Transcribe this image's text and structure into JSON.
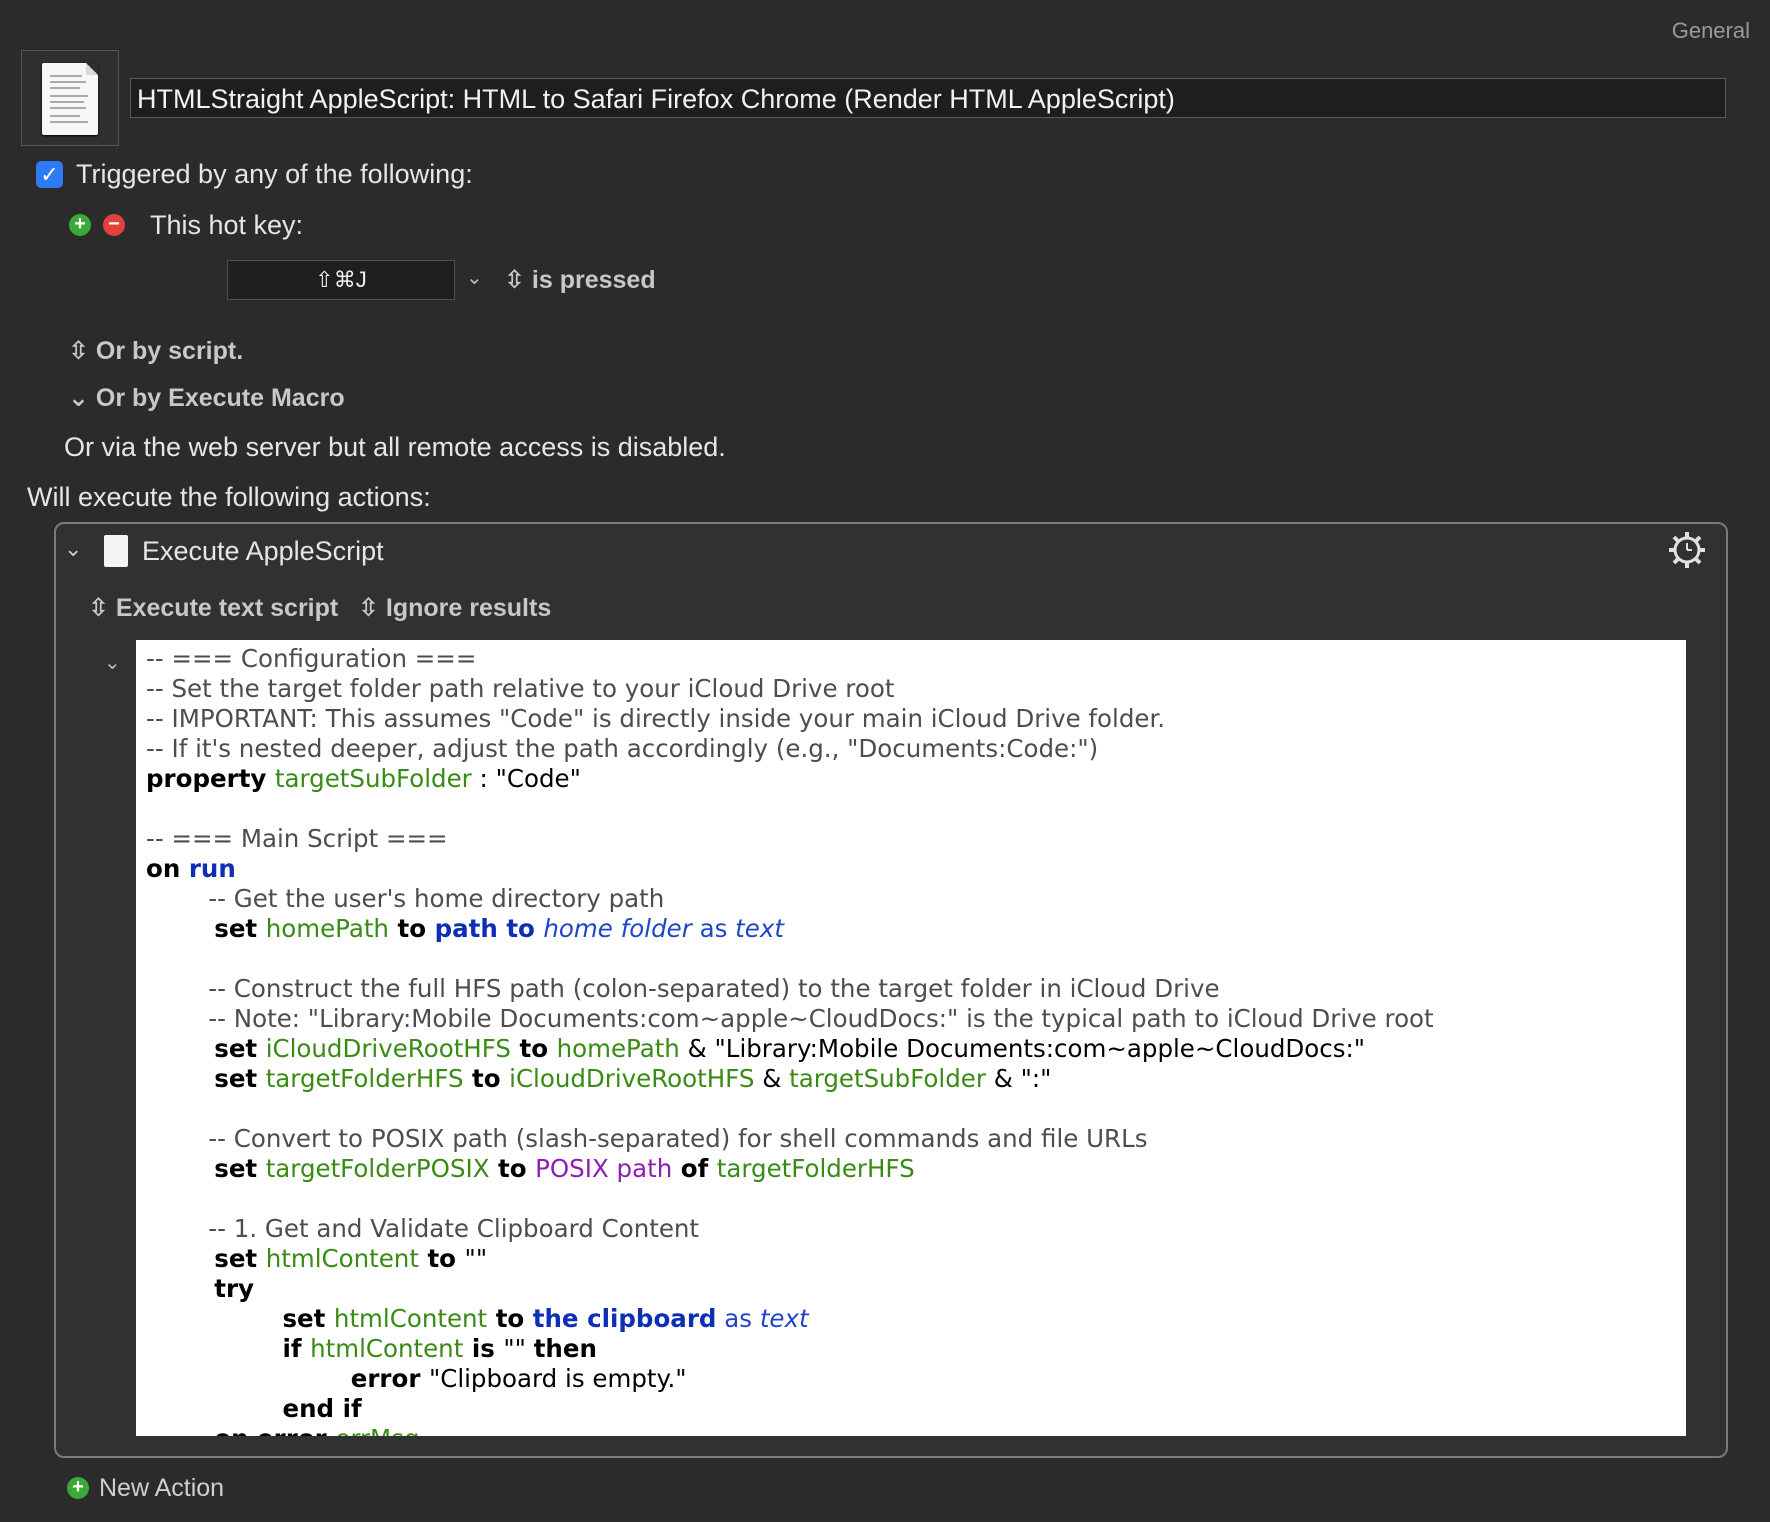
{
  "header": {
    "panel_label": "General"
  },
  "macro": {
    "title": "HTMLStraight AppleScript: HTML to Safari Firefox Chrome (Render HTML AppleScript)",
    "icon": "document-icon"
  },
  "triggers": {
    "enabled_label": "Triggered by any of the following:",
    "hotkey_label": "This hot key:",
    "hotkey_value": "⇧⌘J",
    "hotkey_condition": "is pressed",
    "or_script": "Or by script.",
    "or_execute_macro": "Or by Execute Macro",
    "web_server_note": "Or via the web server but all remote access is disabled."
  },
  "actions": {
    "header": "Will execute the following actions:",
    "items": [
      {
        "title": "Execute AppleScript",
        "mode": "Execute text script",
        "results": "Ignore results"
      }
    ],
    "new_action_label": "New Action"
  },
  "code_lines": [
    [
      [
        "c",
        "-- === Configuration ==="
      ]
    ],
    [
      [
        "c",
        "-- Set the target folder path relative to your iCloud Drive root"
      ]
    ],
    [
      [
        "c",
        "-- IMPORTANT: This assumes \"Code\" is directly inside your main iCloud Drive folder."
      ]
    ],
    [
      [
        "c",
        "-- If it's nested deeper, adjust the path accordingly (e.g., \"Documents:Code:\")"
      ]
    ],
    [
      [
        "k",
        "property "
      ],
      [
        "v",
        "targetSubFolder"
      ],
      [
        "t",
        " : \"Code\""
      ]
    ],
    [
      [
        "t",
        ""
      ]
    ],
    [
      [
        "c",
        "-- === Main Script ==="
      ]
    ],
    [
      [
        "k",
        "on "
      ],
      [
        "b",
        "run"
      ]
    ],
    [
      [
        "c",
        "        -- Get the user's home directory path"
      ]
    ],
    [
      [
        "k",
        "        set "
      ],
      [
        "v",
        "homePath"
      ],
      [
        "k",
        " to "
      ],
      [
        "b",
        "path to "
      ],
      [
        "i",
        "home folder"
      ],
      [
        "a",
        " as "
      ],
      [
        "i",
        "text"
      ]
    ],
    [
      [
        "t",
        ""
      ]
    ],
    [
      [
        "c",
        "        -- Construct the full HFS path (colon-separated) to the target folder in iCloud Drive"
      ]
    ],
    [
      [
        "c",
        "        -- Note: \"Library:Mobile Documents:com~apple~CloudDocs:\" is the typical path to iCloud Drive root"
      ]
    ],
    [
      [
        "k",
        "        set "
      ],
      [
        "v",
        "iCloudDriveRootHFS"
      ],
      [
        "k",
        " to "
      ],
      [
        "v",
        "homePath"
      ],
      [
        "t",
        " & \"Library:Mobile Documents:com~apple~CloudDocs:\""
      ]
    ],
    [
      [
        "k",
        "        set "
      ],
      [
        "v",
        "targetFolderHFS"
      ],
      [
        "k",
        " to "
      ],
      [
        "v",
        "iCloudDriveRootHFS"
      ],
      [
        "t",
        " & "
      ],
      [
        "v",
        "targetSubFolder"
      ],
      [
        "t",
        " & \":\""
      ]
    ],
    [
      [
        "t",
        ""
      ]
    ],
    [
      [
        "c",
        "        -- Convert to POSIX path (slash-separated) for shell commands and file URLs"
      ]
    ],
    [
      [
        "k",
        "        set "
      ],
      [
        "v",
        "targetFolderPOSIX"
      ],
      [
        "k",
        " to "
      ],
      [
        "p",
        "POSIX path"
      ],
      [
        "k",
        " of "
      ],
      [
        "v",
        "targetFolderHFS"
      ]
    ],
    [
      [
        "t",
        ""
      ]
    ],
    [
      [
        "c",
        "        -- 1. Get and Validate Clipboard Content"
      ]
    ],
    [
      [
        "k",
        "        set "
      ],
      [
        "v",
        "htmlContent"
      ],
      [
        "k",
        " to "
      ],
      [
        "t",
        "\"\""
      ]
    ],
    [
      [
        "k",
        "        try"
      ]
    ],
    [
      [
        "k",
        "                set "
      ],
      [
        "v",
        "htmlContent"
      ],
      [
        "k",
        " to "
      ],
      [
        "b",
        "the clipboard"
      ],
      [
        "a",
        " as "
      ],
      [
        "i",
        "text"
      ]
    ],
    [
      [
        "k",
        "                if "
      ],
      [
        "v",
        "htmlContent"
      ],
      [
        "k",
        " is "
      ],
      [
        "t",
        "\"\" "
      ],
      [
        "k",
        "then"
      ]
    ],
    [
      [
        "k",
        "                        error "
      ],
      [
        "t",
        "\"Clipboard is empty.\""
      ]
    ],
    [
      [
        "k",
        "                end if"
      ]
    ],
    [
      [
        "k",
        "        on error "
      ],
      [
        "v",
        "errMsg"
      ]
    ]
  ]
}
